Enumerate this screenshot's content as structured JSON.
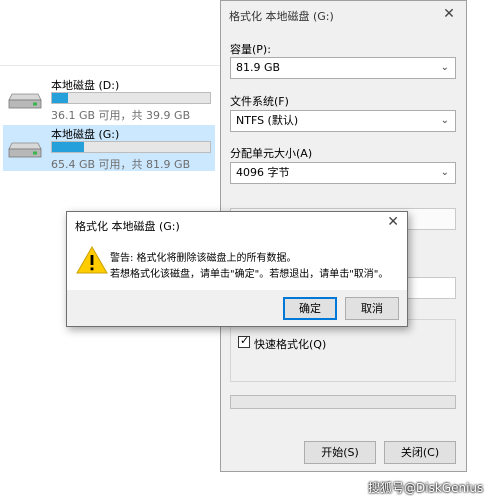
{
  "explorer": {
    "drives": [
      {
        "name": "本地磁盘 (D:)",
        "info": "36.1 GB 可用，共 39.9 GB",
        "used_fraction": 0.1,
        "selected": false
      },
      {
        "name": "本地磁盘 (G:)",
        "info": "65.4 GB 可用，共 81.9 GB",
        "used_fraction": 0.2,
        "selected": true
      }
    ]
  },
  "format_window": {
    "title": "格式化 本地磁盘 (G:)",
    "close": "✕",
    "capacity_label": "容量(P):",
    "capacity_value": "81.9 GB",
    "fs_label": "文件系统(F)",
    "fs_value": "NTFS (默认)",
    "alloc_label": "分配单元大小(A)",
    "alloc_value": "4096 字节",
    "quick_format_label": "快速格式化(Q)",
    "quick_format_checked": true,
    "start_button": "开始(S)",
    "close_button": "关闭(C)"
  },
  "dialog": {
    "title": "格式化 本地磁盘 (G:)",
    "close": "✕",
    "line1": "警告: 格式化将删除该磁盘上的所有数据。",
    "line2": "若想格式化该磁盘，请单击\"确定\"。若想退出，请单击\"取消\"。",
    "ok_button": "确定",
    "cancel_button": "取消"
  },
  "watermark": "搜狐号@DiskGenius",
  "colors": {
    "selection": "#cce8ff",
    "bar_fill": "#26a0da",
    "accent": "#0078d7",
    "warning": "#ffcc00"
  }
}
